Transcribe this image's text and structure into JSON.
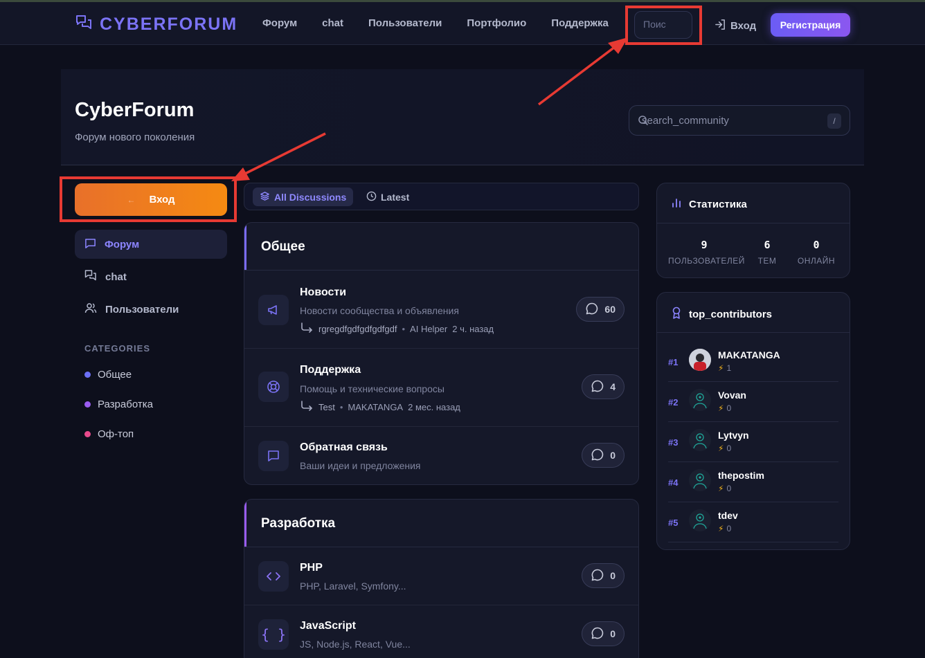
{
  "header": {
    "logo": "CYBERFORUM",
    "nav": [
      "Форум",
      "chat",
      "Пользователи",
      "Портфолио",
      "Поддержка"
    ],
    "search_placeholder": "Поис",
    "login": "Вход",
    "register": "Регистрация"
  },
  "hero": {
    "title": "CyberForum",
    "subtitle": "Форум нового поколения",
    "search_placeholder": "search_community",
    "search_kbd": "/"
  },
  "sidebar": {
    "login_button": "Вход",
    "items": [
      {
        "label": "Форум",
        "icon": "message-square-icon",
        "active": true
      },
      {
        "label": "chat",
        "icon": "messages-icon",
        "active": false
      },
      {
        "label": "Пользователи",
        "icon": "users-icon",
        "active": false
      }
    ],
    "categories_heading": "CATEGORIES",
    "categories": [
      {
        "label": "Общее",
        "color": "#6b6ff5"
      },
      {
        "label": "Разработка",
        "color": "#9a5cf0"
      },
      {
        "label": "Оф-топ",
        "color": "#e84a8c"
      }
    ]
  },
  "tabs": {
    "all": "All Discussions",
    "latest": "Latest"
  },
  "sections": [
    {
      "title": "Общее",
      "forums": [
        {
          "title": "Новости",
          "desc": "Новости сообщества и объявления",
          "last_topic": "rgregdfgdfgdfgdfgdf",
          "last_user": "AI Helper",
          "last_time": "2 ч. назад",
          "count": "60",
          "icon": "megaphone-icon"
        },
        {
          "title": "Поддержка",
          "desc": "Помощь и технические вопросы",
          "last_topic": "Test",
          "last_user": "MAKATANGA",
          "last_time": "2 мес. назад",
          "count": "4",
          "icon": "lifebuoy-icon"
        },
        {
          "title": "Обратная связь",
          "desc": "Ваши идеи и предложения",
          "count": "0",
          "icon": "message-square-icon"
        }
      ]
    },
    {
      "title": "Разработка",
      "forums": [
        {
          "title": "PHP",
          "desc": "PHP, Laravel, Symfony...",
          "count": "0",
          "icon": "code-icon"
        },
        {
          "title": "JavaScript",
          "desc": "JS, Node.js, React, Vue...",
          "count": "0",
          "icon": "braces-icon"
        }
      ]
    }
  ],
  "stats": {
    "title": "Статистика",
    "items": [
      {
        "value": "9",
        "label": "ПОЛЬЗОВАТЕЛЕЙ"
      },
      {
        "value": "6",
        "label": "ТЕМ"
      },
      {
        "value": "0",
        "label": "ОНЛАЙН"
      }
    ]
  },
  "contributors": {
    "title": "top_contributors",
    "items": [
      {
        "rank": "#1",
        "name": "MAKATANGA",
        "score": "1"
      },
      {
        "rank": "#2",
        "name": "Vovan",
        "score": "0"
      },
      {
        "rank": "#3",
        "name": "Lytvyn",
        "score": "0"
      },
      {
        "rank": "#4",
        "name": "thepostim",
        "score": "0"
      },
      {
        "rank": "#5",
        "name": "tdev",
        "score": "0"
      }
    ]
  }
}
